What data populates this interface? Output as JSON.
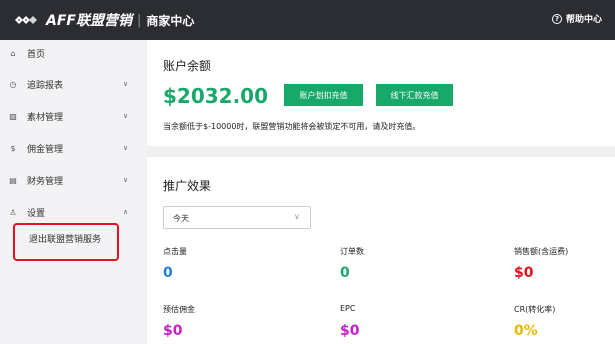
{
  "header": {
    "brand": "AFF联盟营销",
    "separator": "|",
    "subtitle": "商家中心",
    "help_label": "帮助中心",
    "help_icon_glyph": "?"
  },
  "sidebar": {
    "items": [
      {
        "label": "首页",
        "icon": "home-icon",
        "glyph": "⌂",
        "has_chevron": false
      },
      {
        "label": "追踪报表",
        "icon": "chart-icon",
        "glyph": "◷",
        "has_chevron": true,
        "chevron": "∨"
      },
      {
        "label": "素材管理",
        "icon": "image-icon",
        "glyph": "▨",
        "has_chevron": true,
        "chevron": "∨"
      },
      {
        "label": "佣金管理",
        "icon": "coin-icon",
        "glyph": "$",
        "has_chevron": true,
        "chevron": "∨"
      },
      {
        "label": "财务管理",
        "icon": "ledger-icon",
        "glyph": "▤",
        "has_chevron": true,
        "chevron": "∨"
      },
      {
        "label": "设置",
        "icon": "user-icon",
        "glyph": "♙",
        "has_chevron": true,
        "chevron": "∧"
      }
    ],
    "sub_item": "退出联盟营销服务"
  },
  "balance": {
    "title": "账户余额",
    "amount": "$2032.00",
    "btn_deduct": "账户划扣充值",
    "btn_offline": "线下汇款充值",
    "note": "当余额低于$-10000时，联盟营销功能将会被锁定不可用，请及时充值。"
  },
  "promo": {
    "title": "推广效果",
    "period": "今天",
    "period_chevron": "∨",
    "metrics": [
      {
        "label": "点击量",
        "value": "0",
        "color": "#1e7fe0"
      },
      {
        "label": "订单数",
        "value": "0",
        "color": "#17a86a"
      },
      {
        "label": "销售额(含运费)",
        "value": "$0",
        "color": "#e0141e"
      },
      {
        "label": "预估佣金",
        "value": "$0",
        "color": "#c81ec8"
      },
      {
        "label": "EPC",
        "value": "$0",
        "color": "#c81ec8"
      },
      {
        "label": "CR(转化率)",
        "value": "0%",
        "color": "#e8b800"
      }
    ]
  }
}
